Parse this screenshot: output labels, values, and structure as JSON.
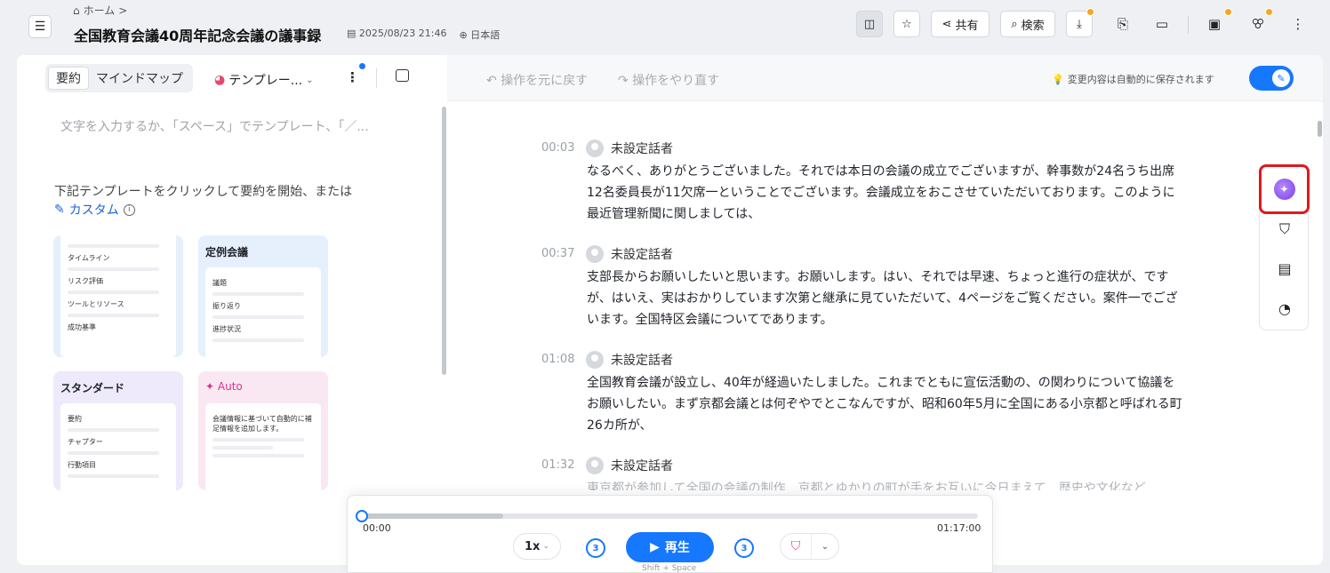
{
  "breadcrumb": {
    "home_icon": "home-icon",
    "home_label": "ホーム",
    "sep": ">"
  },
  "doc": {
    "title": "全国教育会議40周年記念会議の議事録",
    "datetime": "2025/08/23 21:46",
    "language": "日本語"
  },
  "toolbar": {
    "share_label": "共有",
    "search_label": "検索"
  },
  "left": {
    "tabs": [
      "要約",
      "マインドマップ"
    ],
    "template_select": "テンプレー...",
    "editor_placeholder": "文字を入力するか、「スペース」でテンプレート、「／...",
    "hint": "下記テンプレートをクリックして要約を開始、または",
    "custom_label": "カスタム",
    "cards": [
      {
        "title": "",
        "rows": [
          "タイムライン",
          "リスク評価",
          "ツールとリソース",
          "成功基準"
        ]
      },
      {
        "title": "定例会議",
        "rows": [
          "議題",
          "振り返り",
          "進捗状況"
        ]
      },
      {
        "title": "スタンダード",
        "rows": [
          "要約",
          "チャプター",
          "行動項目"
        ]
      },
      {
        "title": "Auto",
        "rows": [
          "会議情報に基づいて自動的に補足情報を追加します。"
        ]
      }
    ]
  },
  "editor": {
    "undo_label": "操作を元に戻す",
    "redo_label": "操作をやり直す",
    "autosave": "変更内容は自動的に保存されます",
    "segments": [
      {
        "time": "00:03",
        "speaker": "未設定話者",
        "text": "なるべく、ありがとうございました。それでは本日の会議の成立でございますが、幹事数が24名うち出席12名委員長が11欠席一ということでございます。会議成立をおこさせていただいております。このように最近管理新聞に関しましては、"
      },
      {
        "time": "00:37",
        "speaker": "未設定話者",
        "text": "支部長からお願いしたいと思います。お願いします。はい、それでは早速、ちょっと進行の症状が、ですが、はいえ、実はおかりしています次第と継承に見ていただいて、4ページをご覧ください。案件一でございます。全国特区会議についてであります。"
      },
      {
        "time": "01:08",
        "speaker": "未設定話者",
        "text": "全国教育会議が設立し、40年が経過いたしました。これまでともに宣伝活動の、の関わりについて協議をお願いしたい。まず京都会議とは何ぞやでとこなんですが、昭和60年5月に全国にある小京都と呼ばれる町26カ所が、"
      },
      {
        "time": "01:32",
        "speaker": "未設定話者",
        "text": "東京都が参加して全国の会議の制作　京都とゆかりの町が手をお互いに今日まえて　歴史や文化など"
      }
    ]
  },
  "player": {
    "current": "00:00",
    "total": "01:17:00",
    "speed": "1x",
    "skip_back": "3",
    "skip_fwd": "3",
    "play_label": "再生",
    "shortcut": "Shift + Space",
    "progress": 0.0
  },
  "colors": {
    "accent": "#1677ff",
    "highlight": "#e0191d"
  }
}
